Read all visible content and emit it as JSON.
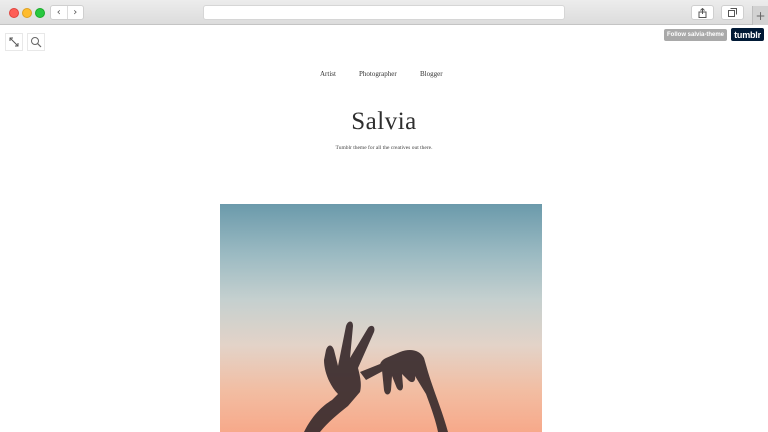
{
  "browser": {
    "back_glyph": "‹",
    "forward_glyph": "›",
    "newtab_glyph": "+",
    "icons": [
      "share-icon",
      "tabs-icon"
    ],
    "traffic_light_colors": [
      "#fe5f57",
      "#febc2e",
      "#28c840"
    ]
  },
  "toolbar": {
    "icons": [
      "expand-arrows-icon",
      "search-icon"
    ]
  },
  "tumblr": {
    "follow_label": "Follow salvia-theme",
    "logo_text": "tumblr",
    "logo_color": "#001935"
  },
  "nav": {
    "items": [
      {
        "label": "Artist"
      },
      {
        "label": "Photographer"
      },
      {
        "label": "Blogger"
      }
    ]
  },
  "blog": {
    "title": "Salvia",
    "tagline": "Tumblr theme for all the creatives out there."
  },
  "post": {
    "image_description": "hands-silhouette-sunset-photo"
  }
}
